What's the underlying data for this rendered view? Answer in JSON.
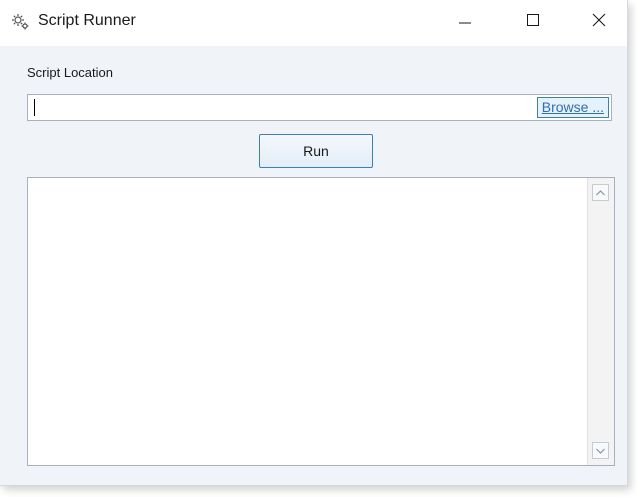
{
  "window": {
    "title": "Script Runner",
    "icon": "gear-icon"
  },
  "form": {
    "label": "Script Location",
    "path_value": "",
    "browse_label": "Browse ...",
    "run_label": "Run"
  },
  "output": {
    "text": ""
  },
  "colors": {
    "accent": "#3c7fb1",
    "link": "#2e6fae",
    "window_bg": "#f0f3f8"
  }
}
